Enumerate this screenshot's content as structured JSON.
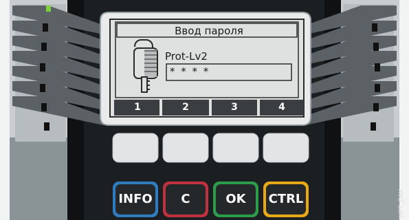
{
  "lcd": {
    "title": "Ввод пароля",
    "level_label": "Prot-Lv2",
    "password_mask": "* * * *",
    "softkeys": [
      "1",
      "2",
      "3",
      "4"
    ]
  },
  "keypad": {
    "info_label": "INFO",
    "c_label": "C",
    "ok_label": "OK",
    "ctrl_label": "CTRL"
  },
  "icons": {
    "lcd": "key-icon",
    "led": "led-icon"
  },
  "watermark": "HPT_ZAX",
  "colors": {
    "panel": "#1c1f21",
    "side_panel": "#8a9396",
    "lcd_bg": "#dfe1e1",
    "info": "#2f7dbe",
    "c": "#c0313f",
    "ok": "#2e9b4a",
    "ctrl": "#e6a817",
    "led_green": "#7fd13b"
  }
}
